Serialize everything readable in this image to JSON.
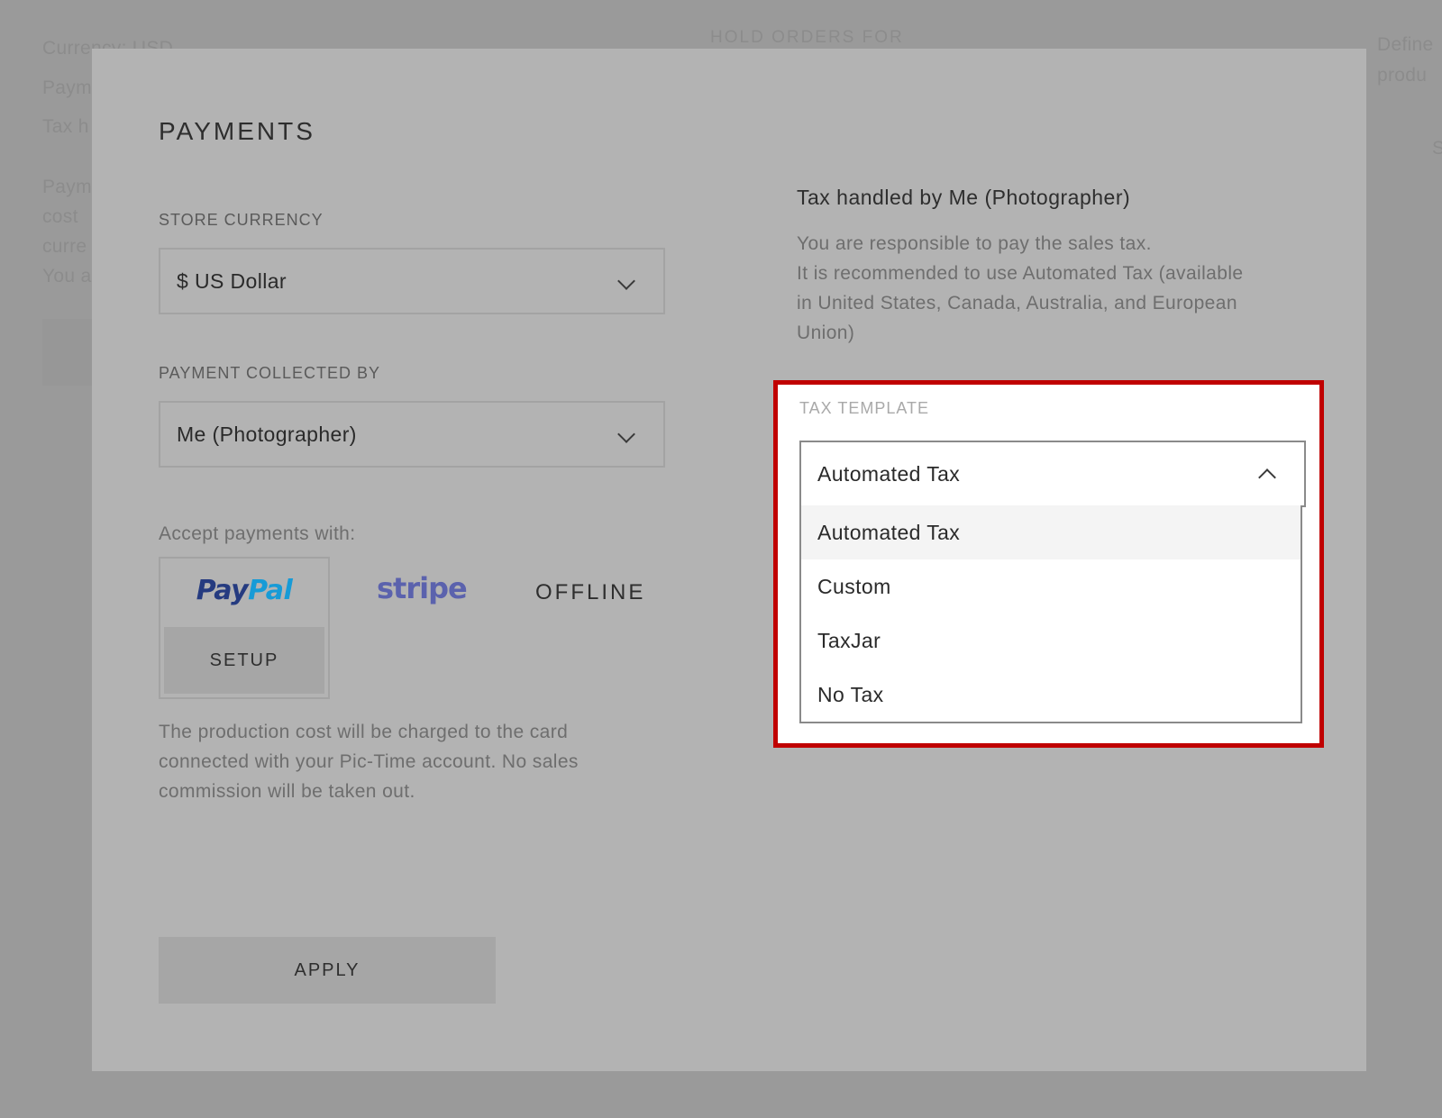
{
  "background": {
    "left_lines": [
      "Currency: USD",
      "Paym",
      "Tax h",
      "Paym",
      "cost",
      "curre",
      "You a"
    ],
    "center_line": "HOLD ORDERS FOR",
    "right_lines": [
      "Define",
      "produ",
      "S"
    ]
  },
  "modal": {
    "title": "PAYMENTS",
    "store_currency": {
      "label": "STORE CURRENCY",
      "value": "$ US Dollar"
    },
    "payment_collected_by": {
      "label": "PAYMENT COLLECTED BY",
      "value": "Me (Photographer)"
    },
    "accept_payments_label": "Accept payments with:",
    "providers": {
      "paypal_part1": "Pay",
      "paypal_part2": "Pal",
      "setup_label": "SETUP",
      "stripe": "stripe",
      "offline": "OFFLINE"
    },
    "production_note": [
      "The production cost will be charged to the card",
      "connected with your Pic-Time account. No sales",
      "commission will be taken out."
    ],
    "apply_label": "APPLY",
    "tax": {
      "heading": "Tax handled by Me (Photographer)",
      "description": [
        "You are responsible to pay the sales tax.",
        "It is recommended to use Automated Tax (available",
        "in United States, Canada, Australia, and European",
        "Union)"
      ],
      "template_label": "TAX TEMPLATE",
      "selected": "Automated Tax",
      "options": [
        "Automated Tax",
        "Custom",
        "TaxJar",
        "No Tax"
      ]
    }
  },
  "colors": {
    "highlight_border": "#c00000",
    "overlay": "#b3b3b3",
    "paypal_dark": "#253b80",
    "paypal_light": "#179bd7",
    "stripe": "#5b62ad"
  }
}
